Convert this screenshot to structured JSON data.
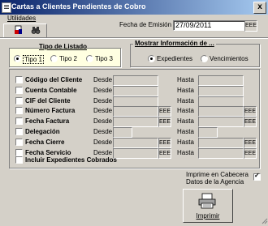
{
  "window": {
    "title": "Cartas a Clientes Pendientes de Cobro",
    "close_glyph": "x"
  },
  "menu": {
    "utilidades": "Utilidades"
  },
  "toolbar": {
    "icons": [
      "report-icon",
      "binoculars-icon"
    ]
  },
  "fecha_emision": {
    "label": "Fecha de Emisión",
    "value": "27/09/2011",
    "cal_label": "EEE"
  },
  "tipo_listado": {
    "title": "Tipo de Listado",
    "options": [
      "Tipo 1",
      "Tipo 2",
      "Tipo 3"
    ],
    "selected": "Tipo 1"
  },
  "mostrar_info": {
    "title": "Mostrar Información de ...",
    "options": [
      "Expedientes",
      "Vencimientos"
    ],
    "selected": "Expedientes"
  },
  "filters": {
    "desde": "Desde",
    "hasta": "Hasta",
    "rows": [
      "Código del Cliente",
      "Cuenta Contable",
      "CIF del Cliente",
      "Número Factura",
      "Fecha Factura",
      "Delegación",
      "Fecha Cierre",
      "Fecha Servicio"
    ],
    "cal_label": "EEE",
    "incluir": "Incluir Expedientes Cobrados"
  },
  "cabecera": {
    "label_line1": "Imprime en Cabecera",
    "label_line2": "Datos de la Agencia",
    "checked": true
  },
  "imprimir": {
    "label": "Imprimir"
  }
}
